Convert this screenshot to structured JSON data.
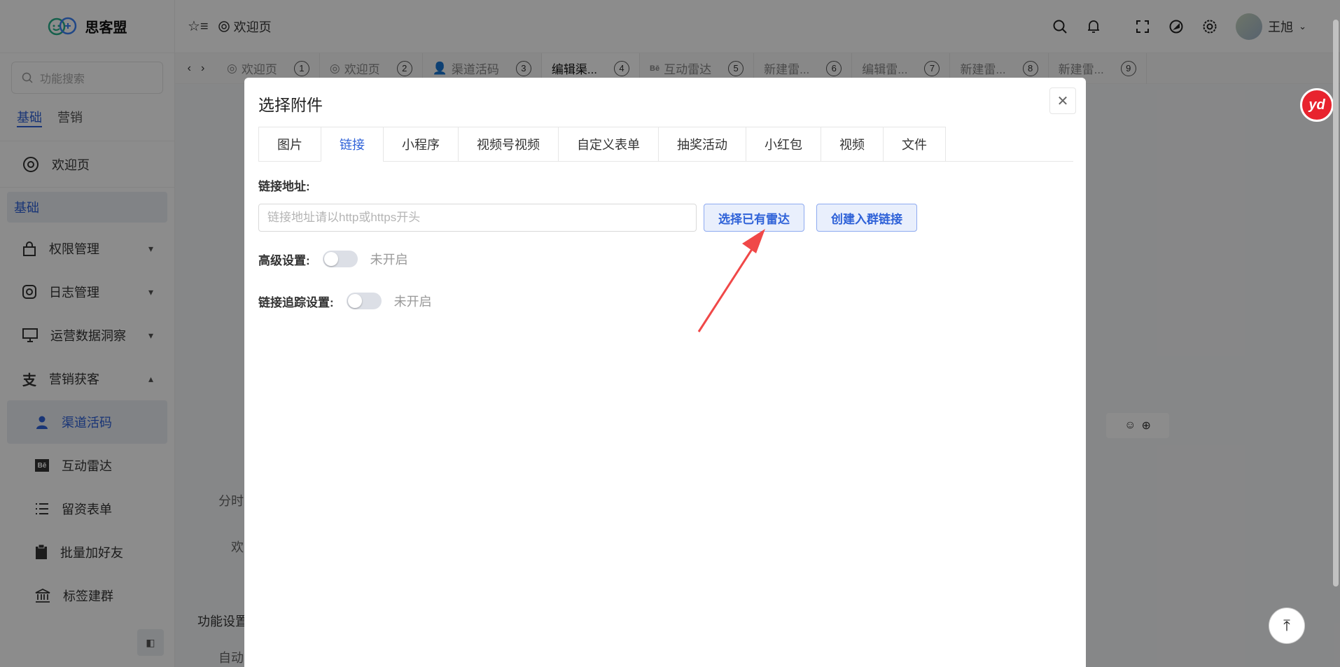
{
  "app": {
    "name": "思客盟"
  },
  "sidebar": {
    "search_placeholder": "功能搜索",
    "tabs": [
      {
        "label": "基础"
      },
      {
        "label": "营销"
      }
    ],
    "welcome": "欢迎页",
    "section": "基础",
    "items": [
      {
        "label": "权限管理",
        "icon": "lock-icon",
        "expand": "collapsed"
      },
      {
        "label": "日志管理",
        "icon": "instagram-icon",
        "expand": "collapsed"
      },
      {
        "label": "运营数据洞察",
        "icon": "monitor-icon",
        "expand": "collapsed"
      },
      {
        "label": "营销获客",
        "icon": "zhi-icon",
        "expand": "expanded"
      }
    ],
    "sub_items": [
      {
        "label": "渠道活码",
        "icon": "user-icon"
      },
      {
        "label": "互动雷达",
        "icon": "behance-icon"
      },
      {
        "label": "留资表单",
        "icon": "list-icon"
      },
      {
        "label": "批量加好友",
        "icon": "clipboard-icon"
      },
      {
        "label": "标签建群",
        "icon": "bank-icon"
      }
    ]
  },
  "header": {
    "crumb": "欢迎页",
    "user": "王旭"
  },
  "tabs": [
    {
      "label": "欢迎页",
      "num": "1",
      "icon": "welcome"
    },
    {
      "label": "欢迎页",
      "num": "2",
      "icon": "welcome"
    },
    {
      "label": "渠道活码",
      "num": "3",
      "icon": "user"
    },
    {
      "label": "编辑渠...",
      "num": "4",
      "icon": ""
    },
    {
      "label": "互动雷达",
      "num": "5",
      "icon": "behance"
    },
    {
      "label": "新建雷...",
      "num": "6",
      "icon": ""
    },
    {
      "label": "编辑雷...",
      "num": "7",
      "icon": ""
    },
    {
      "label": "新建雷...",
      "num": "8",
      "icon": ""
    },
    {
      "label": "新建雷...",
      "num": "9",
      "icon": ""
    }
  ],
  "background": {
    "text1": "分时",
    "text2": "欢",
    "text3": "功能设置",
    "text4": "自动"
  },
  "modal": {
    "title": "选择附件",
    "tabs": [
      "图片",
      "链接",
      "小程序",
      "视频号视频",
      "自定义表单",
      "抽奖活动",
      "小红包",
      "视频",
      "文件"
    ],
    "active_tab": "链接",
    "url_label": "链接地址:",
    "url_placeholder": "链接地址请以http或https开头",
    "btn_select_radar": "选择已有雷达",
    "btn_create_group": "创建入群链接",
    "advanced_label": "高级设置:",
    "advanced_status": "未开启",
    "tracking_label": "链接追踪设置:",
    "tracking_status": "未开启"
  },
  "badge": {
    "text": "yd"
  },
  "colors": {
    "accent": "#2f62d8",
    "annotation_arrow": "#f04848"
  }
}
